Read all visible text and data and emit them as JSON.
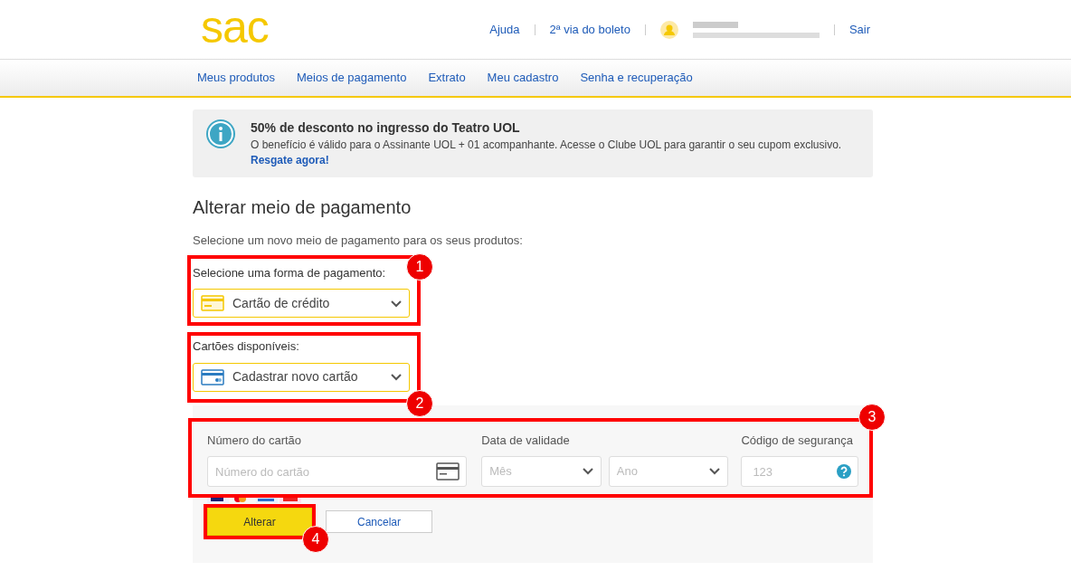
{
  "header": {
    "logo": "sac",
    "links": [
      {
        "label": "Ajuda"
      },
      {
        "label": "2ª via do boleto"
      }
    ],
    "logout": "Sair"
  },
  "nav": [
    {
      "label": "Meus produtos"
    },
    {
      "label": "Meios de pagamento"
    },
    {
      "label": "Extrato"
    },
    {
      "label": "Meu cadastro"
    },
    {
      "label": "Senha e recuperação"
    }
  ],
  "notice": {
    "title": "50% de desconto no ingresso do Teatro UOL",
    "text": "O benefício é válido para o Assinante UOL + 01 acompanhante. Acesse o Clube UOL para garantir o seu cupom exclusivo.",
    "link": "Resgate agora!"
  },
  "page_title": "Alterar meio de pagamento",
  "intro": "Selecione um novo meio de pagamento para os seus produtos:",
  "payment_type": {
    "label": "Selecione uma forma de pagamento:",
    "value": "Cartão de crédito",
    "annotation": "1"
  },
  "cards": {
    "label": "Cartões disponíveis:",
    "value": "Cadastrar novo cartão",
    "annotation": "2"
  },
  "card_form": {
    "annotation": "3",
    "number": {
      "label": "Número do cartão",
      "placeholder": "Número do cartão"
    },
    "expiry": {
      "label": "Data de validade",
      "month_placeholder": "Mês",
      "year_placeholder": "Ano"
    },
    "security": {
      "label": "Código de segurança",
      "placeholder": "123"
    }
  },
  "buttons": [
    {
      "label": "Alterar",
      "kind": "primary",
      "annotation": "4"
    },
    {
      "label": "Cancelar",
      "kind": "secondary"
    }
  ]
}
